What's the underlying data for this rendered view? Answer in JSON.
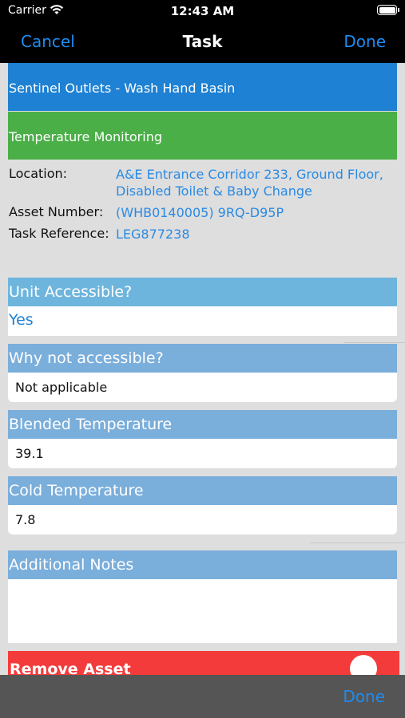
{
  "status": {
    "carrier": "Carrier",
    "time": "12:43 AM"
  },
  "nav": {
    "cancel": "Cancel",
    "title": "Task",
    "done": "Done"
  },
  "banners": {
    "category": "Sentinel Outlets - Wash Hand Basin",
    "task_type": "Temperature Monitoring"
  },
  "info": {
    "location_label": "Location:",
    "location_line1": "A&E Entrance Corridor 233, Ground Floor,",
    "location_line2": "Disabled Toilet & Baby Change",
    "asset_label": "Asset Number:",
    "asset_value": "(WHB0140005) 9RQ-D95P",
    "ref_label": "Task Reference:",
    "ref_value": "LEG877238"
  },
  "form": {
    "unit_accessible": {
      "label": "Unit Accessible?",
      "value": "Yes"
    },
    "why_not": {
      "label": "Why not accessible?",
      "value": "Not applicable"
    },
    "blended": {
      "label": "Blended Temperature",
      "value": "39.1"
    },
    "cold": {
      "label": "Cold Temperature",
      "value": "7.8"
    },
    "notes": {
      "label": "Additional Notes",
      "value": ""
    }
  },
  "remove_asset": {
    "label": "Remove Asset",
    "on": false
  },
  "bottom": {
    "done": "Done"
  },
  "colors": {
    "accent": "#1e8bf0",
    "blue_banner": "#1e81d3",
    "green_banner": "#4aaf47",
    "danger": "#f43b3b"
  }
}
